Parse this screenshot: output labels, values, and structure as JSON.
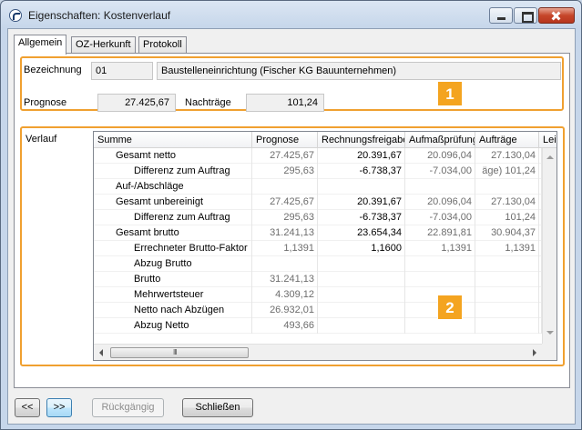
{
  "window": {
    "title": "Eigenschaften: Kostenverlauf"
  },
  "tabs": [
    {
      "label": "Allgemein",
      "active": true
    },
    {
      "label": "OZ-Herkunft",
      "active": false
    },
    {
      "label": "Protokoll",
      "active": false
    }
  ],
  "general": {
    "bezeichnung_label": "Bezeichnung",
    "bezeichnung_code": "01",
    "bezeichnung_text": "Baustelleneinrichtung (Fischer KG Bauunternehmen)",
    "prognose_label": "Prognose",
    "prognose_value": "27.425,67",
    "nachtraege_label": "Nachträge",
    "nachtraege_value": "101,24"
  },
  "badges": {
    "one": "1",
    "two": "2"
  },
  "verlauf": {
    "label": "Verlauf",
    "columns": [
      "Summe",
      "Prognose",
      "Rechnungsfreigabe",
      "Aufmaßprüfung",
      "Aufträge",
      "Leistung"
    ],
    "rows": [
      {
        "name": "Gesamt netto",
        "indent": 1,
        "cells": [
          "27.425,67",
          "20.391,67",
          "20.096,04",
          "27.130,04"
        ]
      },
      {
        "name": "Differenz zum Auftrag",
        "indent": 2,
        "cells": [
          "295,63",
          "-6.738,37",
          "-7.034,00",
          "äge) 101,24"
        ]
      },
      {
        "name": "Auf-/Abschläge",
        "indent": 1,
        "cells": [
          "",
          "",
          "",
          ""
        ]
      },
      {
        "name": "Gesamt unbereinigt",
        "indent": 1,
        "cells": [
          "27.425,67",
          "20.391,67",
          "20.096,04",
          "27.130,04"
        ]
      },
      {
        "name": "Differenz zum Auftrag",
        "indent": 2,
        "cells": [
          "295,63",
          "-6.738,37",
          "-7.034,00",
          "101,24"
        ]
      },
      {
        "name": "Gesamt brutto",
        "indent": 1,
        "cells": [
          "31.241,13",
          "23.654,34",
          "22.891,81",
          "30.904,37"
        ]
      },
      {
        "name": "Errechneter Brutto-Faktor",
        "indent": 2,
        "cells": [
          "1,1391",
          "1,1600",
          "1,1391",
          "1,1391"
        ]
      },
      {
        "name": "Abzug Brutto",
        "indent": 2,
        "cells": [
          "",
          "",
          "",
          ""
        ]
      },
      {
        "name": "Brutto",
        "indent": 2,
        "cells": [
          "31.241,13",
          "",
          "",
          ""
        ]
      },
      {
        "name": "Mehrwertsteuer",
        "indent": 2,
        "cells": [
          "4.309,12",
          "",
          "",
          ""
        ]
      },
      {
        "name": "Netto nach Abzügen",
        "indent": 2,
        "cells": [
          "26.932,01",
          "",
          "",
          ""
        ]
      },
      {
        "name": "Abzug Netto",
        "indent": 2,
        "cells": [
          "493,66",
          "",
          "",
          ""
        ]
      }
    ],
    "scroll_thumb_grip": "III"
  },
  "buttons": {
    "prev": "<<",
    "next": ">>",
    "undo": "Rückgängig",
    "close": "Schließen"
  },
  "colors": {
    "highlight": "#f0a030",
    "badge": "#f4a420"
  }
}
